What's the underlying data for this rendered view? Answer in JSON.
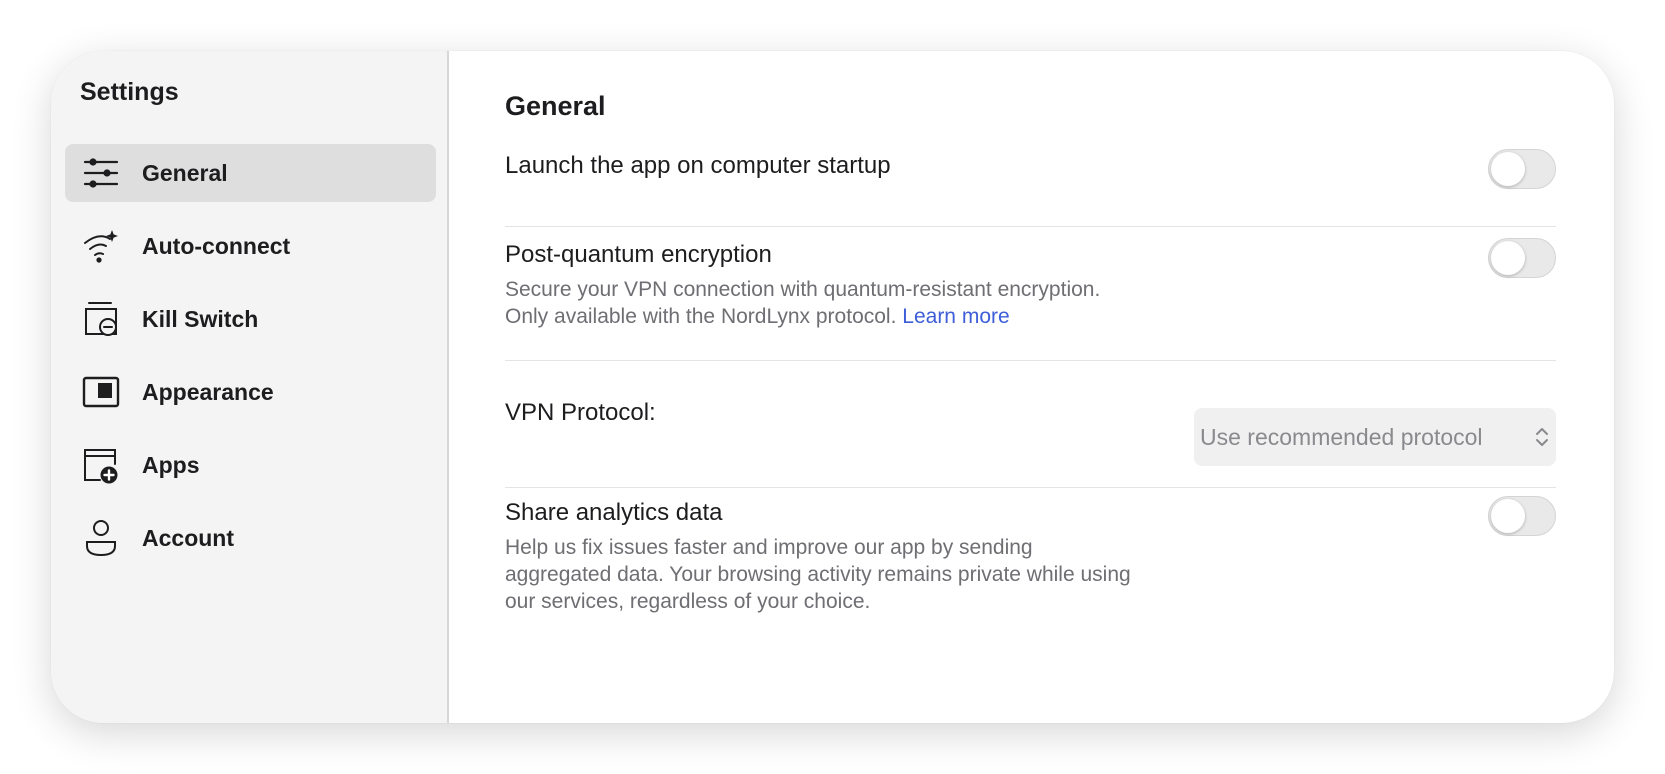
{
  "sidebar": {
    "title": "Settings",
    "items": [
      {
        "label": "General",
        "icon": "sliders-icon",
        "active": true
      },
      {
        "label": "Auto-connect",
        "icon": "wifi-sparkle-icon",
        "active": false
      },
      {
        "label": "Kill Switch",
        "icon": "kill-switch-icon",
        "active": false
      },
      {
        "label": "Appearance",
        "icon": "appearance-icon",
        "active": false
      },
      {
        "label": "Apps",
        "icon": "apps-add-icon",
        "active": false
      },
      {
        "label": "Account",
        "icon": "account-icon",
        "active": false
      }
    ]
  },
  "main": {
    "title": "General",
    "launch_startup": {
      "label": "Launch the app on computer startup",
      "enabled": false
    },
    "post_quantum": {
      "label": "Post-quantum encryption",
      "description_line1": "Secure your VPN connection with quantum-resistant encryption.",
      "description_line2": "Only available with the NordLynx protocol.",
      "link": "Learn more",
      "enabled": false
    },
    "vpn_protocol": {
      "label": "VPN Protocol:",
      "value": "Use recommended protocol"
    },
    "analytics": {
      "label": "Share analytics data",
      "description_line1": "Help us fix issues faster and improve our app by sending",
      "description_line2": "aggregated data. Your browsing activity remains private while using",
      "description_line3": "our services, regardless of your choice.",
      "enabled": false
    }
  },
  "colors": {
    "sidebar_bg": "#f4f4f4",
    "active_item_bg": "#dedede",
    "link": "#3d5ed8",
    "toggle_off": "#e9e9ea",
    "secondary_text": "#6e6e73"
  }
}
